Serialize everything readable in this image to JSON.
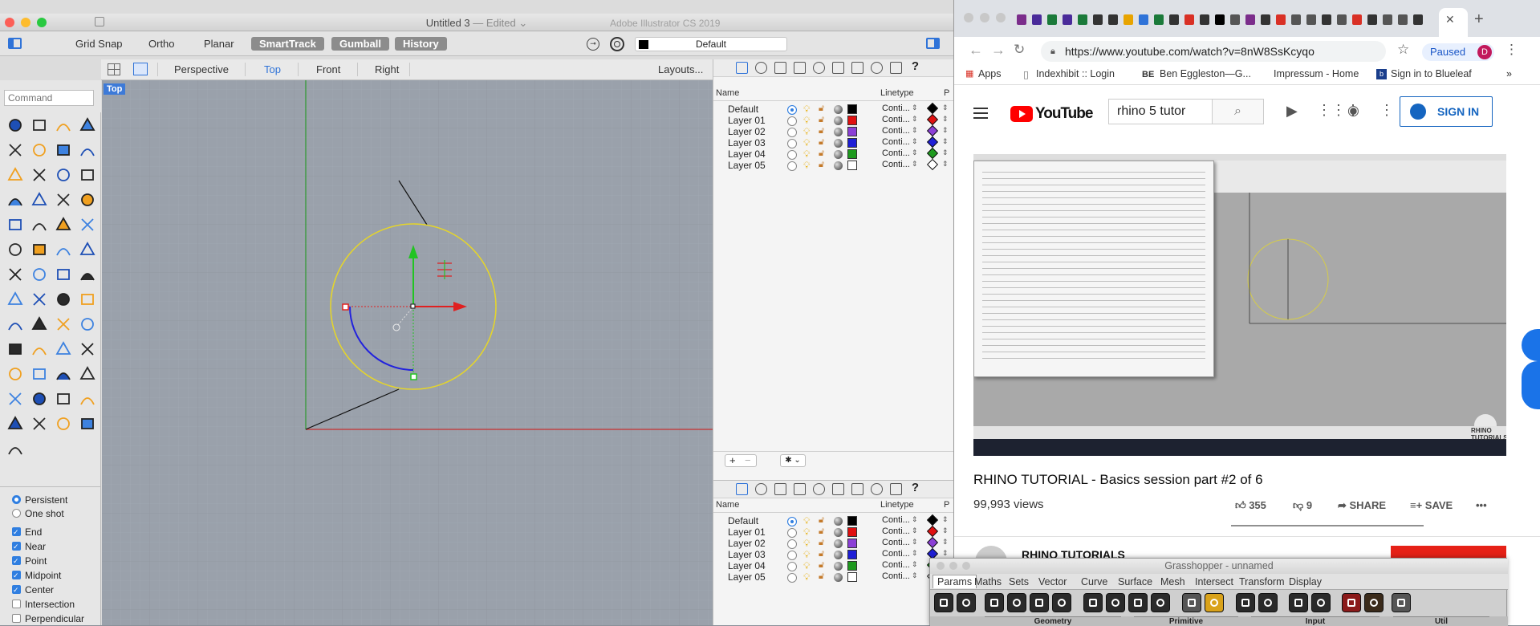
{
  "rhino": {
    "window_title": "Untitled 3",
    "edited_label": "— Edited ⌄",
    "background_title": "Adobe Illustrator CS 2019",
    "toolbar": {
      "grid_snap": "Grid Snap",
      "ortho": "Ortho",
      "planar": "Planar",
      "smarttrack": "SmartTrack",
      "gumball": "Gumball",
      "history": "History",
      "current_layer": "Default"
    },
    "view_tabs": [
      "Perspective",
      "Top",
      "Front",
      "Right"
    ],
    "active_view": "Top",
    "layouts_label": "Layouts...",
    "viewport_label": "Top",
    "command_placeholder": "Command",
    "snaps": {
      "mode": [
        {
          "label": "Persistent",
          "selected": true
        },
        {
          "label": "One shot",
          "selected": false
        }
      ],
      "items": [
        {
          "label": "End",
          "checked": true
        },
        {
          "label": "Near",
          "checked": true
        },
        {
          "label": "Point",
          "checked": true
        },
        {
          "label": "Midpoint",
          "checked": true
        },
        {
          "label": "Center",
          "checked": true
        },
        {
          "label": "Intersection",
          "checked": false
        },
        {
          "label": "Perpendicular",
          "checked": false
        }
      ]
    },
    "layers_header": {
      "name": "Name",
      "linetype": "Linetype",
      "p": "P"
    },
    "layers": [
      {
        "name": "Default",
        "color": "#000000",
        "linetype": "Conti...",
        "current": true
      },
      {
        "name": "Layer 01",
        "color": "#e01010",
        "linetype": "Conti...",
        "current": false
      },
      {
        "name": "Layer 02",
        "color": "#8b3fd6",
        "linetype": "Conti...",
        "current": false
      },
      {
        "name": "Layer 03",
        "color": "#1f1fd6",
        "linetype": "Conti...",
        "current": false
      },
      {
        "name": "Layer 04",
        "color": "#1e9a1e",
        "linetype": "Conti...",
        "current": false
      },
      {
        "name": "Layer 05",
        "color": "#ffffff",
        "linetype": "Conti...",
        "current": false
      }
    ],
    "layer_add": "+",
    "layer_remove": "−",
    "layer_gear": "✱ ⌄"
  },
  "chrome": {
    "url": "https://www.youtube.com/watch?v=8nW8SsKcyqo",
    "paused_label": "Paused",
    "profile_initial": "D",
    "bookmarks": [
      "Apps",
      "Indexhibit :: Login",
      "Ben Eggleston—G...",
      "Impressum - Home",
      "Sign in to Blueleaf"
    ],
    "bookmarks_more": "»",
    "new_tab": "+",
    "close_tab": "✕"
  },
  "youtube": {
    "logo_text": "YouTube",
    "search_value": "rhino 5 tutor",
    "sign_in": "SIGN IN",
    "video_title": "RHINO TUTORIAL - Basics session part #2 of 6",
    "views": "99,993 views",
    "likes": "355",
    "dislikes": "9",
    "share": "SHARE",
    "save": "SAVE",
    "more": "•••",
    "channel": "RHINO TUTORIALS",
    "video_watermark": "RHINO TUTORIALS"
  },
  "grasshopper": {
    "title": "Grasshopper - unnamed",
    "tabs": [
      "Params",
      "Maths",
      "Sets",
      "Vector",
      "Curve",
      "Surface",
      "Mesh",
      "Intersect",
      "Transform",
      "Display"
    ],
    "active_tab": "Params",
    "groups": [
      "Geometry",
      "Primitive",
      "Input",
      "Util"
    ]
  },
  "colors": {
    "accent_blue": "#2f73d8",
    "youtube_red": "#ff0000",
    "viewport_bg": "#9aa1ab"
  }
}
